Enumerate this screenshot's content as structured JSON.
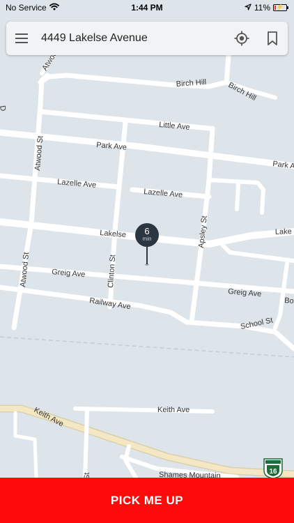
{
  "status_bar": {
    "carrier": "No Service",
    "time": "1:44 PM",
    "battery": "11%",
    "battery_level": 0.11,
    "battery_color": "#e3332a"
  },
  "search_bar": {
    "address": "4449 Lakelse Avenue",
    "menu_icon": "hamburger-menu-icon",
    "locate_icon": "crosshair-locate-icon",
    "bookmark_icon": "bookmark-icon"
  },
  "map": {
    "land_color": "#dde4ea",
    "road_color": "#ffffff",
    "highway_color": "#f3e7c4",
    "streets": {
      "atwood_top": "Atwood",
      "birch_hill_1": "Birch Hill",
      "birch_hill_2": "Birch Hill",
      "little_ave": "Little Ave",
      "park_ave_1": "Park Ave",
      "park_ave_2": "Park A",
      "atwood_st_1": "Atwood St",
      "lazelle_ave_1": "Lazelle Ave",
      "lazelle_ave_2": "Lazelle Ave",
      "apsley_st": "Apsley St",
      "lakelse_1": "Lakelse",
      "lakelse_2": "Lake",
      "atwood_st_2": "Atwood St",
      "clinton_st": "Clinton St",
      "greig_ave_1": "Greig Ave",
      "greig_ave_2": "Greig Ave",
      "bo": "Bo",
      "railway_ave": "Railway Ave",
      "school_st": "School St",
      "keith_ave_1": "Keith Ave",
      "keith_ave_2": "Keith Ave",
      "shames_mountain": "Shames Mountain",
      "st_fragment": "St",
      "d_fragment": "D"
    },
    "highway_shield": {
      "number": "16",
      "icon": "highway-16-shield-icon"
    }
  },
  "pin": {
    "eta_value": "6",
    "eta_unit": "min",
    "color": "#2b3640"
  },
  "action": {
    "label": "PICK ME UP",
    "color": "#ff0a0a"
  }
}
